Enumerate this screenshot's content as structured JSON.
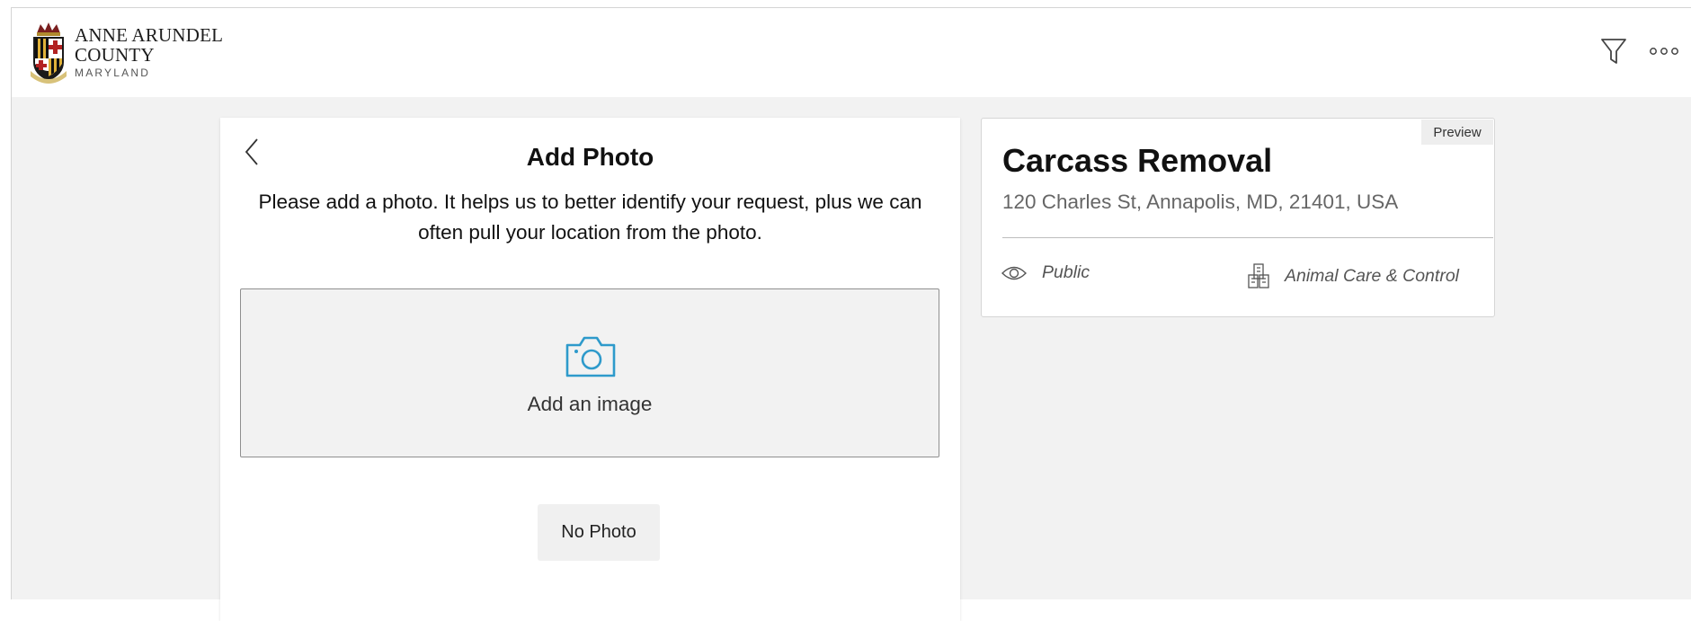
{
  "header": {
    "logo": {
      "line1": "ANNE ARUNDEL",
      "line2": "COUNTY",
      "sub": "MARYLAND"
    },
    "icons": {
      "filter": "filter-icon",
      "more": "more-icon"
    }
  },
  "photo_step": {
    "back_icon": "chevron-left-icon",
    "title": "Add Photo",
    "description": "Please add a photo. It helps us to better identify your request, plus we can often pull your location from the photo.",
    "dropzone_icon": "camera-icon",
    "dropzone_label": "Add an image",
    "no_photo_button": "No Photo"
  },
  "preview": {
    "badge": "Preview",
    "title": "Carcass Removal",
    "address": "120 Charles St, Annapolis, MD, 21401, USA",
    "visibility_icon": "eye-icon",
    "visibility": "Public",
    "department_icon": "building-icon",
    "department": "Animal Care & Control"
  },
  "colors": {
    "accent": "#2e9acb",
    "page_background": "#f2f2f2",
    "card_background": "#ffffff"
  }
}
